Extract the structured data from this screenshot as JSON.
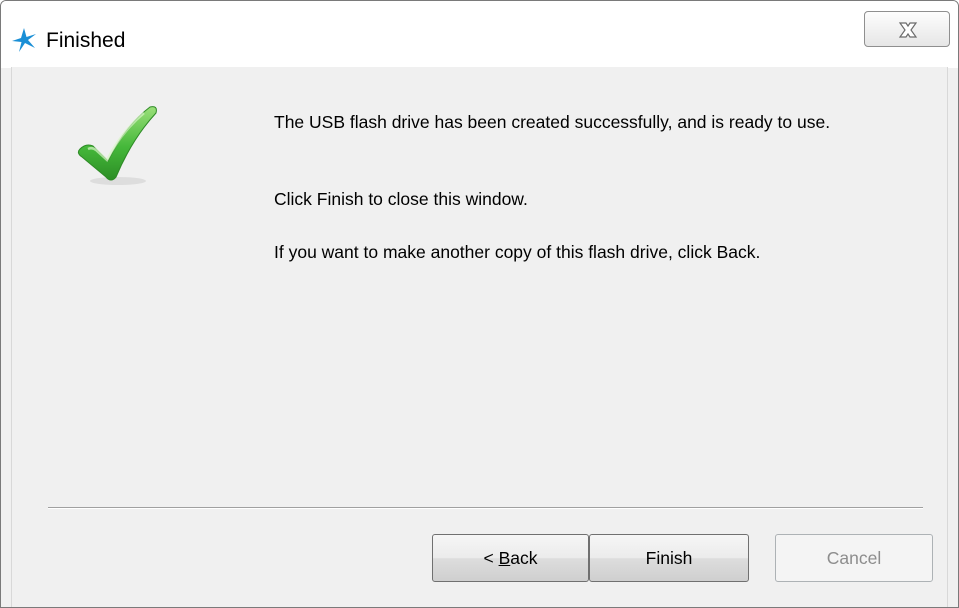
{
  "window": {
    "title": "Finished",
    "app_icon": "star-logo-icon",
    "close_icon": "close-x-icon"
  },
  "content": {
    "status_icon": "checkmark-icon",
    "message_success": "The USB flash drive has been created successfully, and is ready to use.",
    "message_finish": "Click Finish to close this window.",
    "message_back": "If you want to make another copy of this flash drive, click Back."
  },
  "buttons": {
    "back_prefix": "< ",
    "back_mnemonic": "B",
    "back_rest": "ack",
    "finish": "Finish",
    "cancel": "Cancel"
  },
  "colors": {
    "app_icon": "#1a8fd6",
    "check_green": "#3fb53a",
    "dialog_bg": "#f0f0f0",
    "disabled_text": "#8d8d8d"
  }
}
